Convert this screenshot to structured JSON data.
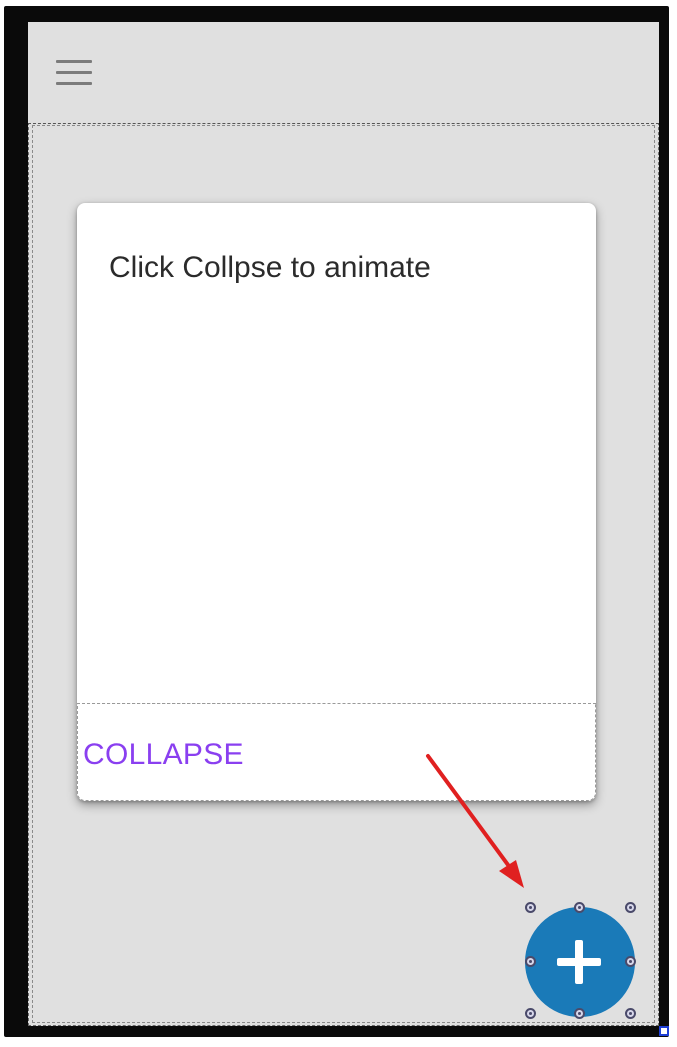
{
  "card": {
    "text": "Click Collpse to animate",
    "action_label": "COLLAPSE"
  },
  "icons": {
    "menu": "hamburger-menu-icon",
    "fab": "plus-icon",
    "annotation": "red-arrow-icon"
  },
  "colors": {
    "screen_background": "#e0e0e0",
    "card_background": "#ffffff",
    "action_text": "#8a3ff0",
    "fab_background": "#1a7ab8",
    "annotation_arrow": "#e02020"
  }
}
